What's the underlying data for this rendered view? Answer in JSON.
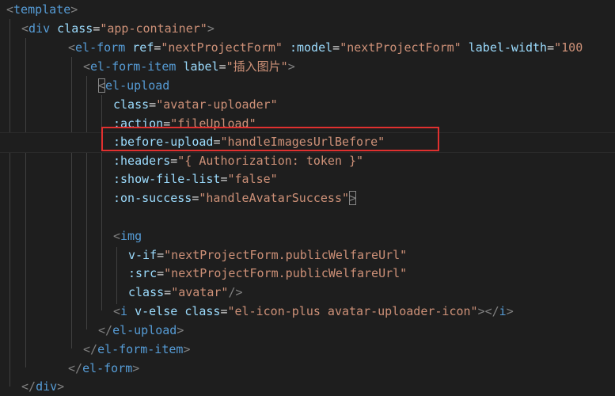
{
  "editor": {
    "lines": [
      [
        "<",
        "template",
        ">"
      ],
      [
        "<",
        "div",
        " ",
        "class",
        "=",
        "\"app-container\"",
        ">"
      ],
      [
        "<",
        "el-form",
        " ",
        "ref",
        "=",
        "\"nextProjectForm\"",
        " ",
        ":model",
        "=",
        "\"nextProjectForm\"",
        " ",
        "label-width",
        "=",
        "\"100"
      ],
      [
        "<",
        "el-form-item",
        " ",
        "label",
        "=",
        "\"插入图片\"",
        ">"
      ],
      [
        "<",
        "el-upload"
      ],
      [
        "class",
        "=",
        "\"avatar-uploader\""
      ],
      [
        ":action",
        "=",
        "\"fileUpload\""
      ],
      [
        ":before-upload",
        "=",
        "\"handleImagesUrlBefore\""
      ],
      [
        ":headers",
        "=",
        "\"{ Authorization: token }\""
      ],
      [
        ":show-file-list",
        "=",
        "\"false\""
      ],
      [
        ":on-success",
        "=",
        "\"handleAvatarSuccess\"",
        ">"
      ],
      [],
      [
        "<",
        "img"
      ],
      [
        "v-if",
        "=",
        "\"nextProjectForm.publicWelfareUrl\""
      ],
      [
        ":src",
        "=",
        "\"nextProjectForm.publicWelfareUrl\""
      ],
      [
        "class",
        "=",
        "\"avatar\"",
        "/>"
      ],
      [
        "<",
        "i",
        " ",
        "v-else",
        " ",
        "class",
        "=",
        "\"el-icon-plus avatar-uploader-icon\"",
        "></",
        "i",
        ">"
      ],
      [
        "</",
        "el-upload",
        ">"
      ],
      [
        "</",
        "el-form-item",
        ">"
      ],
      [
        "</",
        "el-form",
        ">"
      ],
      [
        "</",
        "div",
        ">"
      ]
    ]
  },
  "colors": {
    "background": "#1e1e1e",
    "tag": "#569cd6",
    "attribute": "#9cdcfe",
    "string": "#ce9178",
    "punctuation": "#808080",
    "highlight": "#e0302f"
  }
}
